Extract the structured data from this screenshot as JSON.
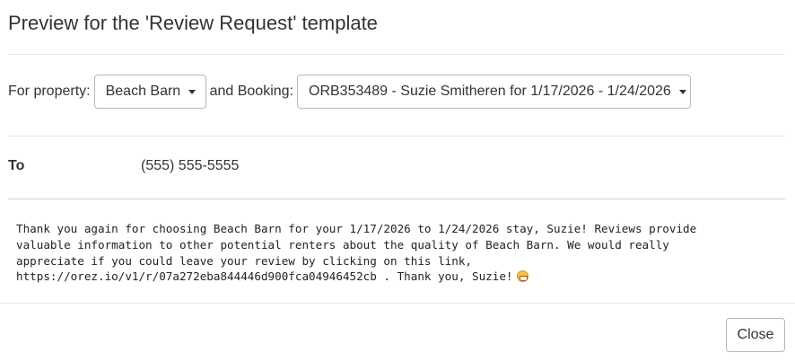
{
  "modal": {
    "title": "Preview for the 'Review Request' template"
  },
  "selectors": {
    "property_label": "For property:",
    "property_value": "Beach Barn",
    "booking_label": "and Booking:",
    "booking_value": "ORB353489 - Suzie Smitheren for 1/17/2026 - 1/24/2026"
  },
  "recipient": {
    "to_label": "To",
    "to_value": "(555) 555-5555"
  },
  "message": {
    "body": "Thank you again for choosing Beach Barn for your 1/17/2026 to 1/24/2026 stay, Suzie! Reviews provide\nvaluable information to other potential renters about the quality of Beach Barn. We would really\nappreciate if you could leave your review by clicking on this link,\nhttps://orez.io/v1/r/07a272eba844446d900fca04946452cb . Thank you, Suzie!",
    "emoji_icon": "grinning-face-icon"
  },
  "footer": {
    "close_label": "Close"
  }
}
